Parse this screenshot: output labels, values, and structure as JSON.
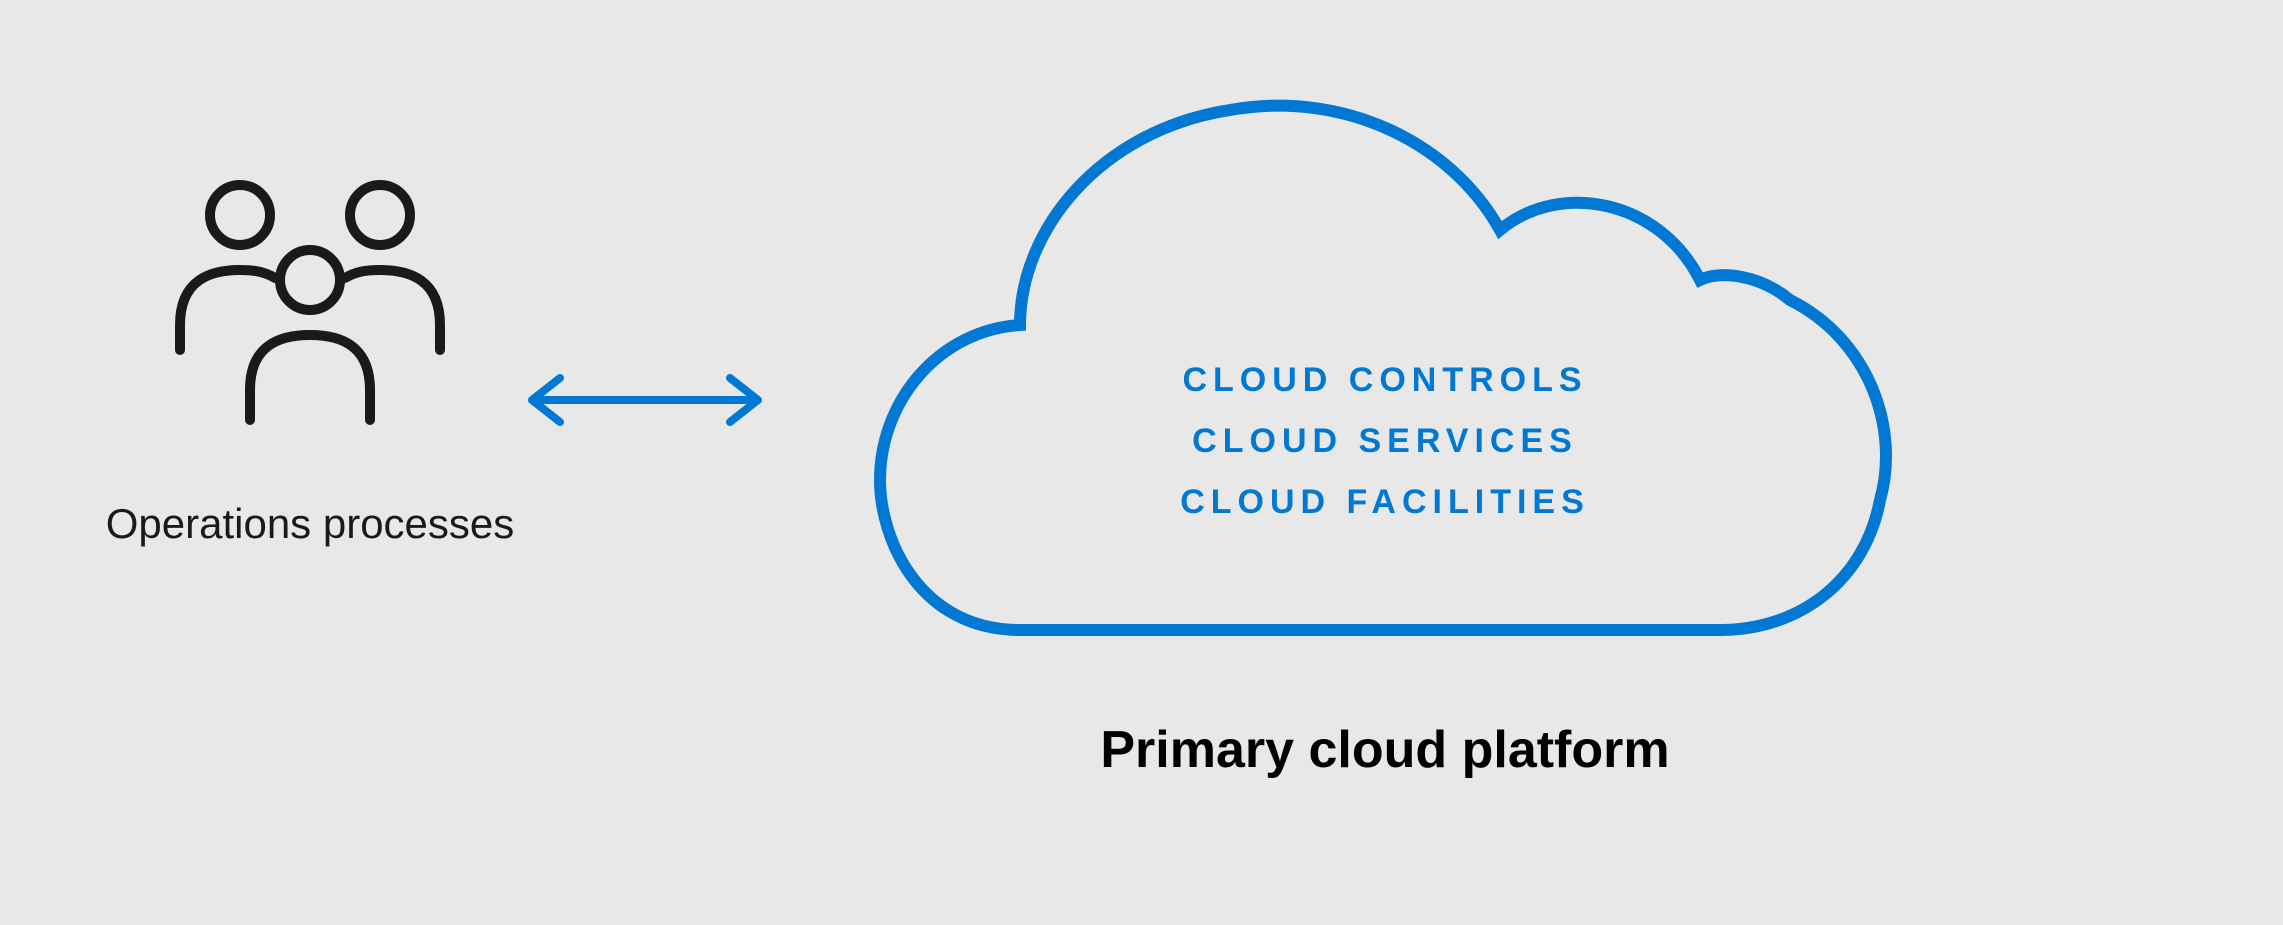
{
  "diagram": {
    "operations": {
      "label": "Operations processes"
    },
    "cloud": {
      "items": {
        "item1": "CLOUD CONTROLS",
        "item2": "CLOUD SERVICES",
        "item3": "CLOUD FACILITIES"
      },
      "label": "Primary cloud platform"
    },
    "colors": {
      "blue": "#0078d4",
      "black": "#1a1a1a",
      "background": "#e8e8e8"
    }
  }
}
